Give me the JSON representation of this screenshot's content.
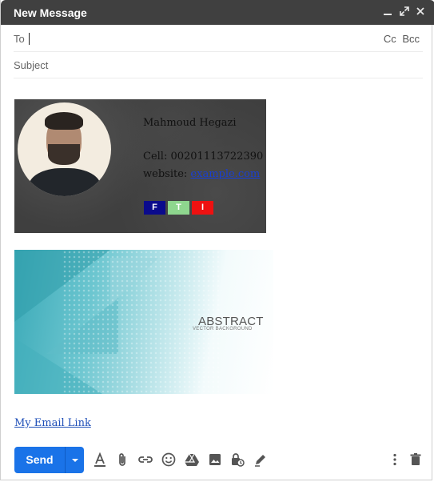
{
  "window": {
    "title": "New Message",
    "controls": [
      "minimize-icon",
      "expand-icon",
      "close-icon"
    ]
  },
  "to": {
    "label": "To",
    "value": ""
  },
  "cc_bcc": {
    "cc": "Cc",
    "bcc": "Bcc"
  },
  "subject": {
    "placeholder": "Subject",
    "value": ""
  },
  "signature": {
    "name": "Mahmoud Hegazi",
    "cell": "Cell: 00201113722390",
    "website_prefix": "website:",
    "website_link": "example.com",
    "social": [
      {
        "label": "F",
        "color": "#0a0a8c"
      },
      {
        "label": "T",
        "color": "#8ed68e"
      },
      {
        "label": "I",
        "color": "#ee1111"
      }
    ]
  },
  "banner": {
    "title": "ABSTRACT",
    "subtitle": "VECTOR BACKGROUND"
  },
  "email_link": "My Email Link",
  "toolbar": {
    "send_label": "Send",
    "accent": "#1a73e8",
    "icons": [
      "format-text-icon",
      "attach-icon",
      "link-icon",
      "emoji-icon",
      "drive-icon",
      "photo-icon",
      "confidential-mode-icon",
      "signature-icon",
      "more-options-icon",
      "trash-icon"
    ]
  }
}
